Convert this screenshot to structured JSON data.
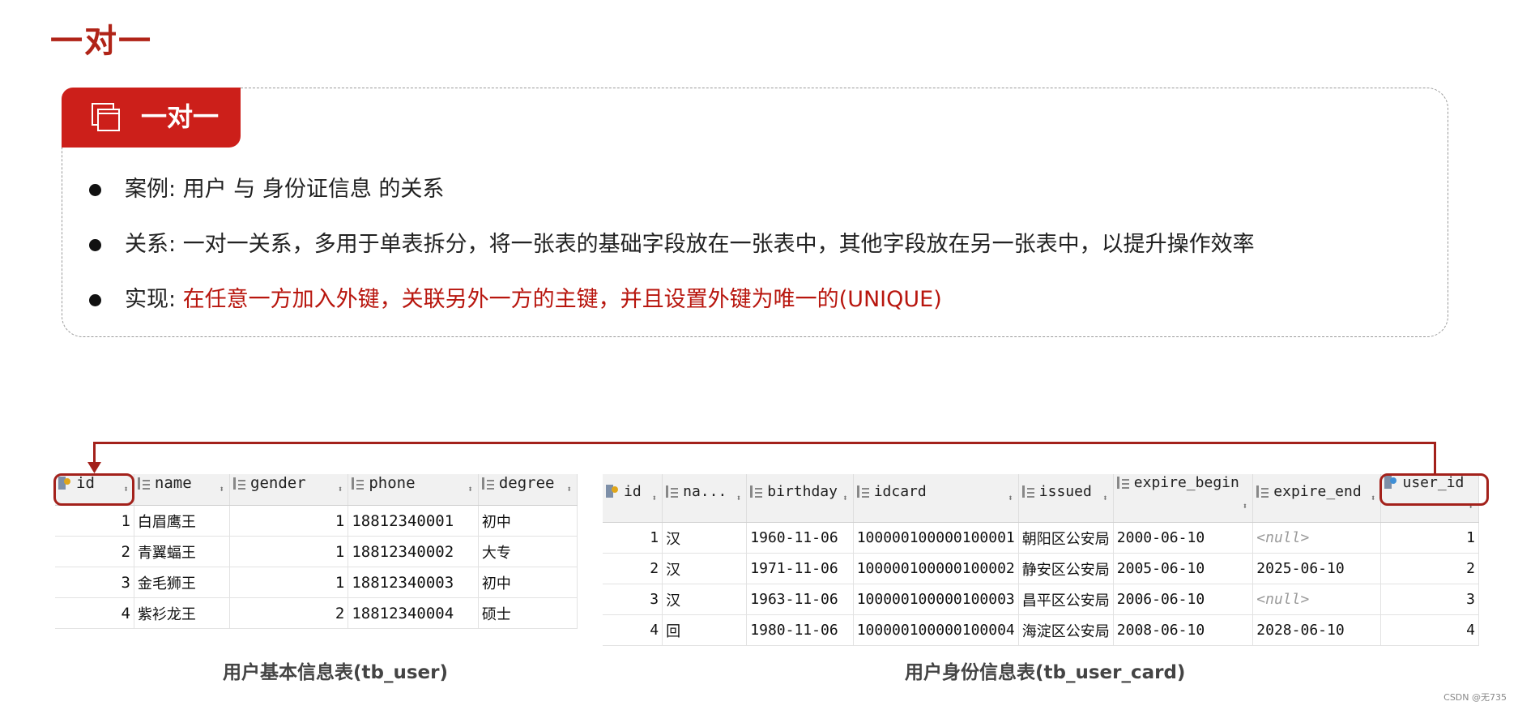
{
  "page_title": "一对一",
  "tab_label": "一对一",
  "bullets": [
    {
      "label": "案例: ",
      "text": "用户 与 身份证信息 的关系",
      "highlight": ""
    },
    {
      "label": "关系: ",
      "text": "一对一关系，多用于单表拆分，将一张表的基础字段放在一张表中，其他字段放在另一张表中，以提升操作效率",
      "highlight": ""
    },
    {
      "label": "实现: ",
      "text": "",
      "highlight": "在任意一方加入外键，关联另外一方的主键，并且设置外键为唯一的(UNIQUE)"
    }
  ],
  "tb_user": {
    "caption": "用户基本信息表(tb_user)",
    "columns": [
      "id",
      "name",
      "gender",
      "phone",
      "degree"
    ],
    "rows": [
      [
        "1",
        "白眉鹰王",
        "1",
        "18812340001",
        "初中"
      ],
      [
        "2",
        "青翼蝠王",
        "1",
        "18812340002",
        "大专"
      ],
      [
        "3",
        "金毛狮王",
        "1",
        "18812340003",
        "初中"
      ],
      [
        "4",
        "紫衫龙王",
        "2",
        "18812340004",
        "硕士"
      ]
    ]
  },
  "tb_user_card": {
    "caption": "用户身份信息表(tb_user_card)",
    "columns": [
      "id",
      "na...",
      "birthday",
      "idcard",
      "issued",
      "expire_begin",
      "expire_end",
      "user_id"
    ],
    "rows": [
      [
        "1",
        "汉",
        "1960-11-06",
        "100000100000100001",
        "朝阳区公安局",
        "2000-06-10",
        "<null>",
        "1"
      ],
      [
        "2",
        "汉",
        "1971-11-06",
        "100000100000100002",
        "静安区公安局",
        "2005-06-10",
        "2025-06-10",
        "2"
      ],
      [
        "3",
        "汉",
        "1963-11-06",
        "100000100000100003",
        "昌平区公安局",
        "2006-06-10",
        "<null>",
        "3"
      ],
      [
        "4",
        "回",
        "1980-11-06",
        "100000100000100004",
        "海淀区公安局",
        "2008-06-10",
        "2028-06-10",
        "4"
      ]
    ]
  },
  "watermark": "CSDN @无735",
  "colors": {
    "accent": "#cc1f1a",
    "highlight_text": "#b8160e",
    "frame": "#a3211b"
  },
  "icons": {
    "tab": "stacked-windows-icon",
    "pk": "primary-key-icon",
    "fk": "foreign-key-icon",
    "column": "column-icon"
  }
}
